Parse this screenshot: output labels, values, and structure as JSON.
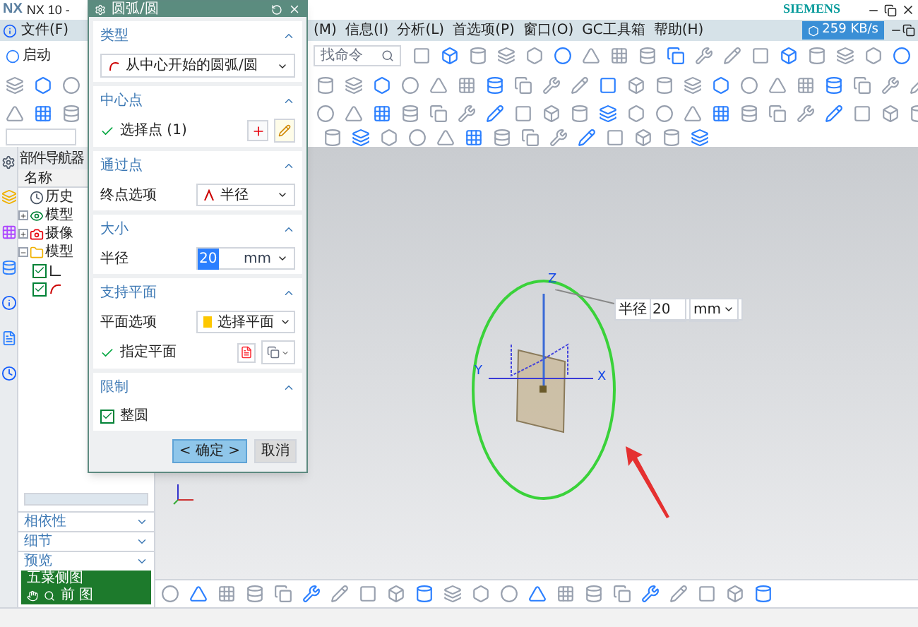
{
  "window": {
    "logo": "NX",
    "title": "NX 10 -",
    "brand": "SIEMENS"
  },
  "menu": {
    "left": [
      "文件(F)"
    ],
    "right": [
      "(M)",
      "信息(I)",
      "分析(L)",
      "首选项(P)",
      "窗口(O)",
      "GC工具箱",
      "帮助(H)"
    ]
  },
  "net_speed": "259 KB/s",
  "toolbar": {
    "start": "启动",
    "search_placeholder": "找命令"
  },
  "navigator": {
    "title": "部件导航器",
    "column": "名称",
    "tree": [
      {
        "label": "历史",
        "kind": "history"
      },
      {
        "label": "模型",
        "kind": "views",
        "expanded": false
      },
      {
        "label": "摄像",
        "kind": "camera",
        "expanded": false
      },
      {
        "label": "模型",
        "kind": "folder",
        "expanded": true,
        "children": [
          {
            "kind": "datum",
            "checked": true
          },
          {
            "kind": "arc",
            "checked": true
          }
        ]
      }
    ],
    "panels": [
      {
        "label": "相依性",
        "expanded": false
      },
      {
        "label": "细节",
        "expanded": false
      },
      {
        "label": "预览",
        "expanded": false
      }
    ]
  },
  "status": {
    "line_1": "五菜侧图",
    "line_2": "前 图"
  },
  "dialog": {
    "title": "圆弧/圆",
    "sections": [
      {
        "title": "类型",
        "expanded": true,
        "rows": [
          {
            "kind": "dropdown",
            "value": "从中心开始的圆弧/圆"
          }
        ]
      },
      {
        "title": "中心点",
        "expanded": true,
        "rows": [
          {
            "kind": "pick",
            "label": "选择点 (1)",
            "checked": true
          }
        ]
      },
      {
        "title": "通过点",
        "expanded": true,
        "rows": [
          {
            "kind": "option",
            "label": "终点选项",
            "value": "半径"
          }
        ]
      },
      {
        "title": "大小",
        "expanded": true,
        "rows": [
          {
            "kind": "number",
            "label": "半径",
            "value": "20",
            "unit": "mm",
            "selected": true
          }
        ]
      },
      {
        "title": "支持平面",
        "expanded": true,
        "rows": [
          {
            "kind": "option",
            "label": "平面选项",
            "value": "选择平面"
          },
          {
            "kind": "plane",
            "label": "指定平面",
            "checked": true
          }
        ]
      },
      {
        "title": "限制",
        "expanded": true,
        "rows": [
          {
            "kind": "checkbox",
            "label": "整圆",
            "checked": true
          }
        ]
      }
    ],
    "buttons": [
      {
        "label": "< 确定 >",
        "primary": true
      },
      {
        "label": "取消",
        "primary": false
      }
    ]
  },
  "canvas": {
    "axes": [
      "Z",
      "X",
      "Y"
    ],
    "radius_tag": {
      "label": "半径",
      "value": "20",
      "unit": "mm"
    }
  }
}
